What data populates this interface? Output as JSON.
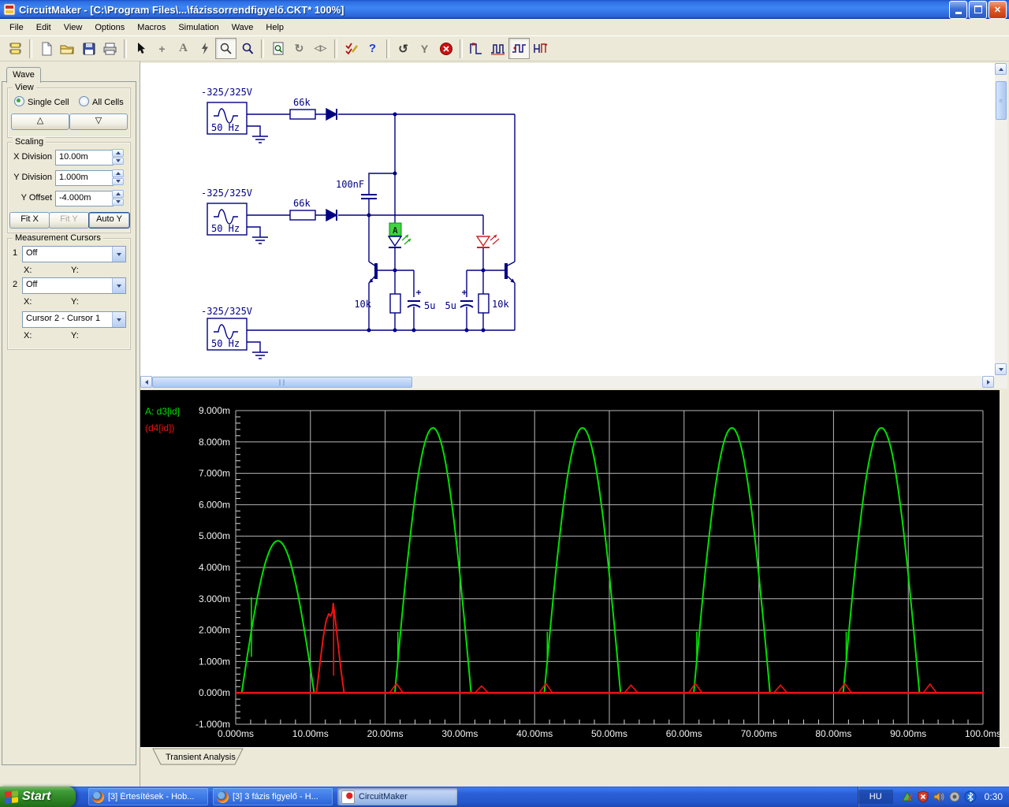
{
  "window": {
    "title": "CircuitMaker - [C:\\Program Files\\...\\fázissorrendfigyelő.CKT* 100%]"
  },
  "menu": {
    "items": [
      "File",
      "Edit",
      "View",
      "Options",
      "Macros",
      "Simulation",
      "Wave",
      "Help"
    ]
  },
  "toolbar": {
    "glyphs": {
      "wire": "+",
      "text": "A",
      "rotate": "↻",
      "flip": "◁▷",
      "help": "?",
      "undo": "↺",
      "wrench": "Y"
    }
  },
  "wave_panel": {
    "tab_label": "Wave",
    "view": {
      "legend": "View",
      "single_cell": "Single Cell",
      "all_cells": "All Cells",
      "up_glyph": "△",
      "down_glyph": "▽"
    },
    "scaling": {
      "legend": "Scaling",
      "x_division_label": "X Division",
      "x_division_value": "10.00m",
      "y_division_label": "Y Division",
      "y_division_value": "1.000m",
      "y_offset_label": "Y Offset",
      "y_offset_value": "-4.000m",
      "fit_x": "Fit X",
      "fit_y": "Fit Y",
      "auto_y": "Auto Y"
    },
    "cursors": {
      "legend": "Measurement Cursors",
      "row1_num": "1",
      "row1_value": "Off",
      "row2_num": "2",
      "row2_value": "Off",
      "diff_value": "Cursor 2 - Cursor 1",
      "x_label": "X:",
      "y_label": "Y:"
    }
  },
  "schematic": {
    "source_label": "-325/325V",
    "source_freq": "50 Hz",
    "r_series": "66k",
    "c_coupling": "100nF",
    "r_load": "10k",
    "c_filter": "5u",
    "probe_label": "A",
    "wire_color": "#000084"
  },
  "chart_data": {
    "type": "line",
    "title": "Transient Analysis",
    "x_unit": "ms",
    "y_unit": "m",
    "xlim": [
      0,
      100
    ],
    "ylim": [
      -1,
      9
    ],
    "x_ticks": [
      "0.000ms",
      "10.00ms",
      "20.00ms",
      "30.00ms",
      "40.00ms",
      "50.00ms",
      "60.00ms",
      "70.00ms",
      "80.00ms",
      "90.00ms",
      "100.0ms"
    ],
    "y_ticks": [
      "9.000m",
      "8.000m",
      "7.000m",
      "6.000m",
      "5.000m",
      "4.000m",
      "3.000m",
      "2.000m",
      "1.000m",
      "0.000m",
      "-1.000m"
    ],
    "x_minor_step": 2,
    "y_minor_step": 0.2,
    "background": "#000000",
    "grid_color": "#b9b9b9",
    "series": [
      {
        "name": "A: d3[id]",
        "color": "#00e000",
        "shape": "half_sine_humps_ms_mA",
        "humps": [
          {
            "start": 0.8,
            "end": 10.5,
            "peak": 4.85
          },
          {
            "start": 21.3,
            "end": 31.5,
            "peak": 8.45
          },
          {
            "start": 41.3,
            "end": 51.5,
            "peak": 8.45
          },
          {
            "start": 61.3,
            "end": 71.5,
            "peak": 8.45
          },
          {
            "start": 81.3,
            "end": 91.5,
            "peak": 8.45
          }
        ],
        "glitches": [
          {
            "x": 2.1,
            "y1": 3.05,
            "y2": 1.15
          },
          {
            "x": 21.7,
            "y1": 1.95,
            "y2": 0.95
          },
          {
            "x": 41.7,
            "y1": 1.95,
            "y2": 0.95
          },
          {
            "x": 61.7,
            "y1": 1.95,
            "y2": 0.95
          },
          {
            "x": 81.7,
            "y1": 1.95,
            "y2": 0.95
          }
        ]
      },
      {
        "name": "(d4[id])",
        "color": "#ee1111",
        "baseline": 0,
        "points": [
          [
            10.8,
            0
          ],
          [
            11.2,
            0.8
          ],
          [
            11.7,
            1.75
          ],
          [
            12.1,
            2.3
          ],
          [
            12.45,
            2.52
          ],
          [
            12.7,
            2.45
          ],
          [
            12.95,
            2.6
          ],
          [
            13.05,
            2.85
          ],
          [
            13.3,
            2.4
          ],
          [
            13.7,
            1.55
          ],
          [
            14.1,
            0.7
          ],
          [
            14.5,
            0
          ]
        ],
        "glitch": {
          "x": 13.1,
          "y1": 2.85,
          "y2": 0.55
        },
        "blips": [
          {
            "x": 21.5,
            "h": 0.3
          },
          {
            "x": 32.9,
            "h": 0.22
          },
          {
            "x": 41.5,
            "h": 0.3
          },
          {
            "x": 52.9,
            "h": 0.25
          },
          {
            "x": 61.5,
            "h": 0.3
          },
          {
            "x": 72.9,
            "h": 0.25
          },
          {
            "x": 81.5,
            "h": 0.3
          },
          {
            "x": 92.9,
            "h": 0.28
          }
        ]
      }
    ]
  },
  "result_tab": {
    "label": "Transient Analysis"
  },
  "taskbar": {
    "start_label": "Start",
    "tasks": [
      {
        "label": "[3] Értesítések - Hob...",
        "icon": "firefox",
        "active": false
      },
      {
        "label": "[3] 3 fázis figyelő - H...",
        "icon": "firefox",
        "active": false
      },
      {
        "label": "CircuitMaker",
        "icon": "circuitmaker",
        "active": true
      }
    ],
    "tray": {
      "language": "HU",
      "time": "0:30"
    }
  }
}
